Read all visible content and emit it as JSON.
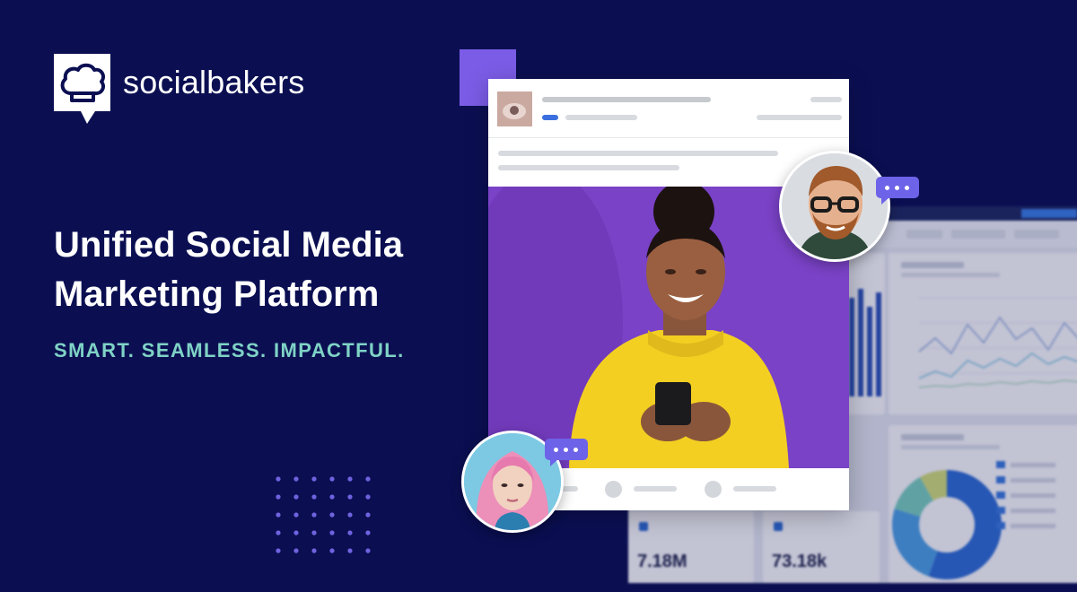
{
  "brand": {
    "name": "socialbakers",
    "background": "#0b0f52",
    "accent": "#7b5ce6",
    "tagline_color": "#7fd3c6"
  },
  "hero": {
    "headline_line1": "Unified Social Media",
    "headline_line2": "Marketing Platform",
    "tagline": "SMART. SEAMLESS. IMPACTFUL."
  },
  "dashboard": {
    "metrics": [
      "7.18M",
      "73.18k"
    ],
    "donut_colors": [
      "#2f6fd6",
      "#4ea3e6",
      "#7dd3c0",
      "#d7e27a"
    ]
  },
  "icons": {
    "logo": "chef-hat-speech-bubble-icon",
    "chat": "chat-bubble-dots-icon"
  }
}
